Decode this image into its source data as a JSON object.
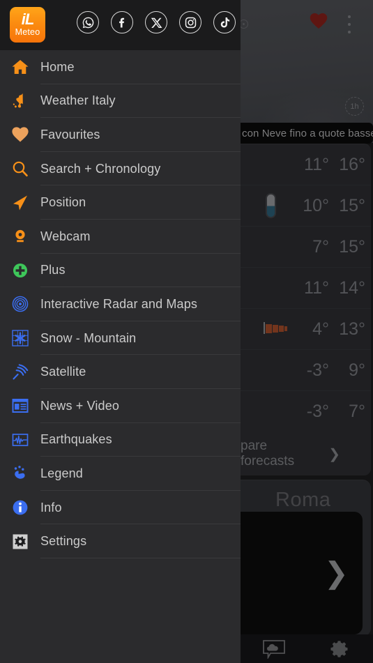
{
  "app": {
    "brand_line1": "iL",
    "brand_line2": "Meteo",
    "accent_orange": "#f79018",
    "accent_blue": "#3b6ef0",
    "accent_green": "#3ec75a",
    "drawer_bg": "#2b2b2d"
  },
  "socials": [
    {
      "name": "whatsapp-icon",
      "label": "WhatsApp"
    },
    {
      "name": "facebook-icon",
      "label": "Facebook"
    },
    {
      "name": "x-icon",
      "label": "X"
    },
    {
      "name": "instagram-icon",
      "label": "Instagram"
    },
    {
      "name": "tiktok-icon",
      "label": "TikTok"
    }
  ],
  "menu": {
    "items": [
      {
        "label": "Home",
        "icon": "home-icon"
      },
      {
        "label": "Weather Italy",
        "icon": "italy-map-icon"
      },
      {
        "label": "Favourites",
        "icon": "heart-icon"
      },
      {
        "label": "Search + Chronology",
        "icon": "search-icon"
      },
      {
        "label": "Position",
        "icon": "navigation-arrow-icon"
      },
      {
        "label": "Webcam",
        "icon": "webcam-pin-icon"
      },
      {
        "label": "Plus",
        "icon": "plus-circle-icon"
      },
      {
        "label": "Interactive Radar and Maps",
        "icon": "radar-icon"
      },
      {
        "label": "Snow - Mountain",
        "icon": "snowflake-grid-icon"
      },
      {
        "label": "Satellite",
        "icon": "satellite-waves-icon"
      },
      {
        "label": "News + Video",
        "icon": "news-layout-icon"
      },
      {
        "label": "Earthquakes",
        "icon": "seismograph-icon"
      },
      {
        "label": "Legend",
        "icon": "tap-hand-icon"
      },
      {
        "label": "Info",
        "icon": "info-circle-icon"
      },
      {
        "label": "Settings",
        "icon": "gear-icon"
      }
    ]
  },
  "background": {
    "alert_banner": "con Neve fino a quote basse",
    "hour_badge": "1h",
    "forecast_rows": [
      {
        "min": "11°",
        "max": "16°",
        "icon": ""
      },
      {
        "min": "10°",
        "max": "15°",
        "icon": "thermometer-icon"
      },
      {
        "min": "7°",
        "max": "15°",
        "icon": ""
      },
      {
        "min": "11°",
        "max": "14°",
        "icon": ""
      },
      {
        "min": "4°",
        "max": "13°",
        "icon": "windsock-icon"
      },
      {
        "min": "-3°",
        "max": "9°",
        "icon": ""
      },
      {
        "min": "-3°",
        "max": "7°",
        "icon": ""
      }
    ],
    "compare_cta": "pare forecasts",
    "compare_chevron": "❯",
    "city_title": "Roma",
    "video_chevron": "❯",
    "bottom_nav": [
      {
        "name": "cloud-chat-icon"
      },
      {
        "name": "gear-icon"
      }
    ]
  }
}
